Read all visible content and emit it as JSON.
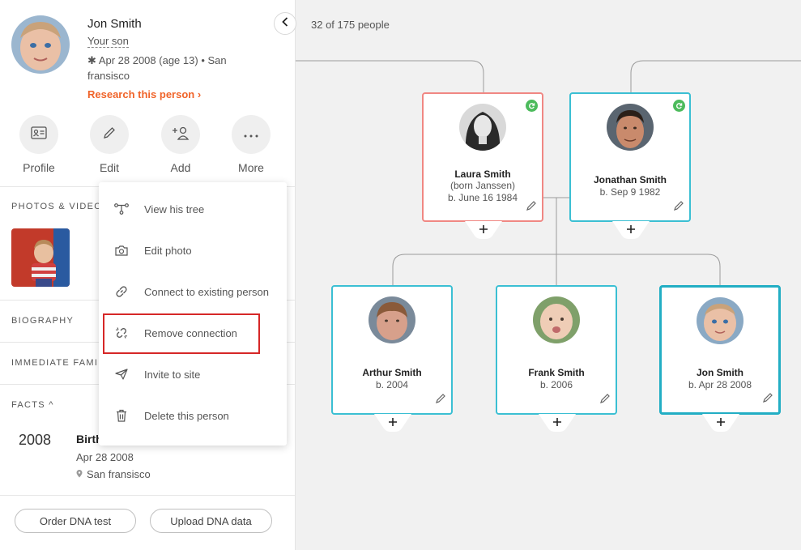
{
  "person": {
    "name": "Jon Smith",
    "relation": "Your son",
    "birth_symbol": "✱",
    "birth": "Apr 28 2008 (age 13)",
    "place_sep": "•",
    "place": "San fransisco",
    "research": "Research this person ›"
  },
  "actions": [
    {
      "label": "Profile",
      "icon": "profile-card-icon"
    },
    {
      "label": "Edit",
      "icon": "pencil-icon"
    },
    {
      "label": "Add",
      "icon": "add-person-icon"
    },
    {
      "label": "More",
      "icon": "more-dots-icon"
    }
  ],
  "sections": {
    "photos": "PHOTOS & VIDEOS",
    "biography": "BIOGRAPHY",
    "family": "IMMEDIATE FAMILY",
    "facts": "FACTS ^"
  },
  "fact": {
    "year": "2008",
    "title": "Birth",
    "date": "Apr 28 2008",
    "place": "San fransisco"
  },
  "buttons": {
    "dna_test": "Order DNA test",
    "dna_upload": "Upload DNA data"
  },
  "menu": [
    {
      "label": "View his tree",
      "icon": "tree-icon"
    },
    {
      "label": "Edit photo",
      "icon": "camera-icon"
    },
    {
      "label": "Connect to existing person",
      "icon": "link-icon"
    },
    {
      "label": "Remove connection",
      "icon": "unlink-icon"
    },
    {
      "label": "Invite to site",
      "icon": "send-icon"
    },
    {
      "label": "Delete this person",
      "icon": "trash-icon"
    }
  ],
  "tree": {
    "count": "32 of 175 people",
    "people": [
      {
        "name": "Laura Smith",
        "extra": "(born Janssen)",
        "birth": "b. June 16 1984"
      },
      {
        "name": "Jonathan Smith",
        "birth": "b. Sep 9 1982"
      },
      {
        "name": "Arthur Smith",
        "birth": "b. 2004"
      },
      {
        "name": "Frank Smith",
        "birth": "b. 2006"
      },
      {
        "name": "Jon Smith",
        "birth": "b. Apr 28 2008"
      }
    ]
  },
  "colors": {
    "accent_orange": "#f0642a",
    "card_male": "#3bbfd3",
    "card_female": "#f08783",
    "sync_green": "#4cbb5c",
    "highlight_red": "#d62727"
  }
}
